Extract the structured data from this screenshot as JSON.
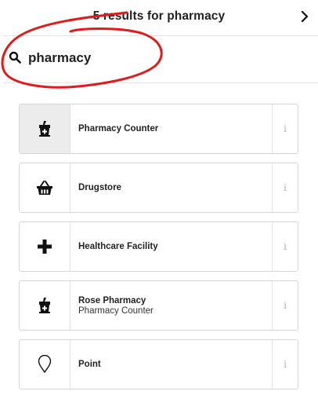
{
  "header": {
    "title": "5 results for pharmacy"
  },
  "search": {
    "value": "pharmacy",
    "icon": "search-icon"
  },
  "annotation": {
    "color": "#e01b1b"
  },
  "results": [
    {
      "title": "Pharmacy Counter",
      "subtitle": "",
      "icon": "pharmacy-mortar-icon",
      "selected": true,
      "info": "i"
    },
    {
      "title": "Drugstore",
      "subtitle": "",
      "icon": "basket-icon",
      "selected": false,
      "info": "i"
    },
    {
      "title": "Healthcare Facility",
      "subtitle": "",
      "icon": "plus-icon",
      "selected": false,
      "info": "i"
    },
    {
      "title": "Rose Pharmacy",
      "subtitle": "Pharmacy Counter",
      "icon": "pharmacy-mortar-icon",
      "selected": false,
      "info": "i"
    },
    {
      "title": "Point",
      "subtitle": "",
      "icon": "map-pin-icon",
      "selected": false,
      "info": "i"
    }
  ]
}
